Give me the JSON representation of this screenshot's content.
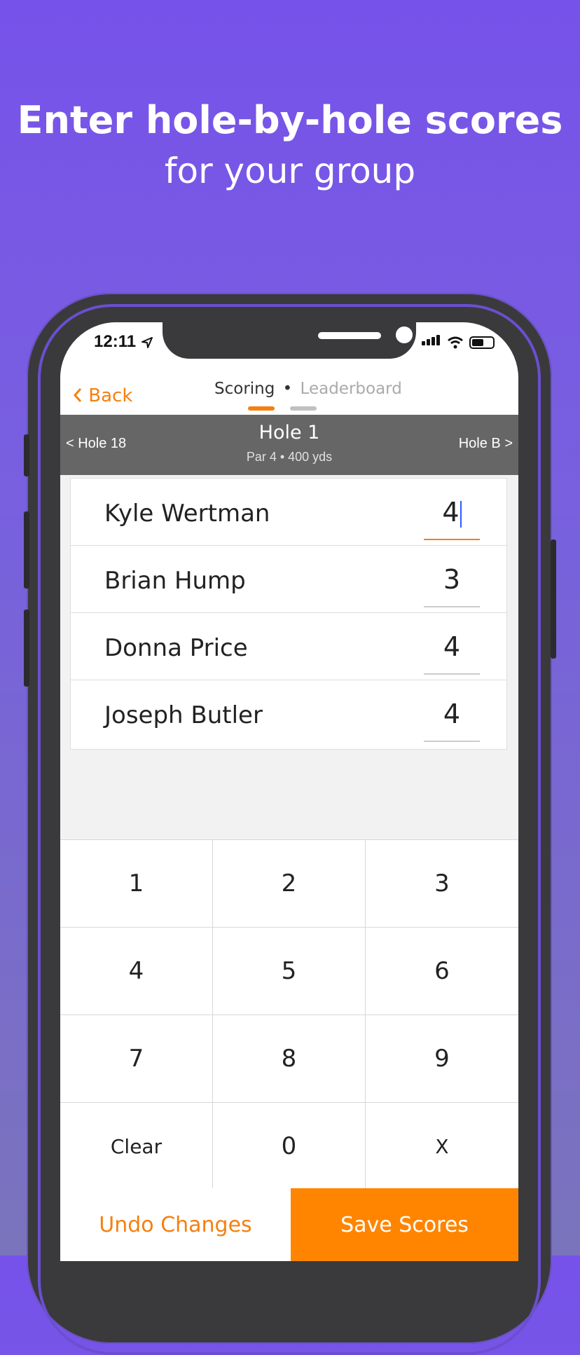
{
  "headline": {
    "line1": "Enter hole-by-hole scores",
    "line2": "for your group"
  },
  "status": {
    "time": "12:11"
  },
  "nav": {
    "back_label": "Back",
    "tab_scoring": "Scoring",
    "tab_separator": "•",
    "tab_leaderboard": "Leaderboard"
  },
  "hole": {
    "prev_label": "< Hole 18",
    "title": "Hole 1",
    "subtitle": "Par 4 • 400 yds",
    "next_label": "Hole B >"
  },
  "players": [
    {
      "name": "Kyle Wertman",
      "score": "4"
    },
    {
      "name": "Brian Hump",
      "score": "3"
    },
    {
      "name": "Donna Price",
      "score": "4"
    },
    {
      "name": "Joseph Butler",
      "score": "4"
    }
  ],
  "keypad": [
    "1",
    "2",
    "3",
    "4",
    "5",
    "6",
    "7",
    "8",
    "9",
    "Clear",
    "0",
    "X"
  ],
  "actions": {
    "undo_label": "Undo Changes",
    "save_label": "Save Scores"
  },
  "colors": {
    "accent": "#ff8500",
    "background": "#7752ea",
    "hole_bar": "#666666"
  }
}
